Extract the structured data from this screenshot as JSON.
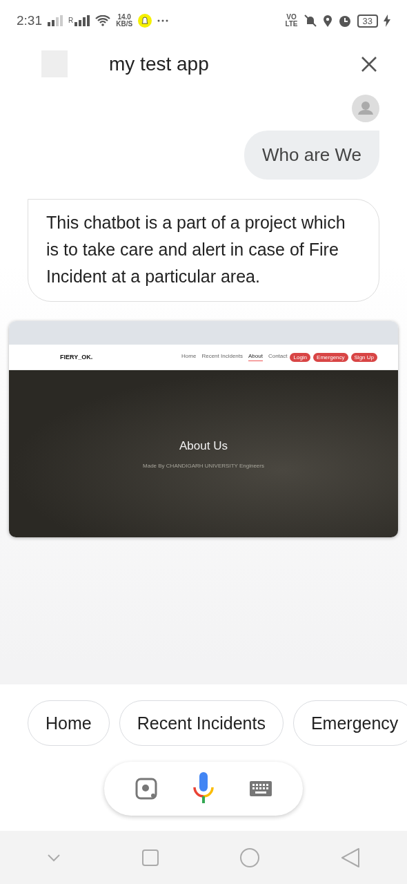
{
  "status_bar": {
    "time": "2:31",
    "roaming": "R",
    "speed_value": "14.0",
    "speed_unit": "KB/S",
    "volte_top": "VO",
    "volte_bottom": "LTE",
    "battery": "33"
  },
  "header": {
    "title": "my test app"
  },
  "messages": [
    {
      "kind": "user",
      "text": "Who are We"
    },
    {
      "kind": "bot",
      "text": "This chatbot is a part of a project which is to take care and alert in case of Fire Incident at a particular area."
    },
    {
      "kind": "screenshot",
      "brand": "FIERY_OK.",
      "nav_links": [
        {
          "label": "Home",
          "selected": false
        },
        {
          "label": "Recent Incidents",
          "selected": false
        },
        {
          "label": "About",
          "selected": true
        },
        {
          "label": "Contact",
          "selected": false
        }
      ],
      "nav_buttons": [
        "Login",
        "Emergency",
        "Sign Up"
      ],
      "hero_title": "About Us",
      "hero_subtitle": "Made By CHANDIGARH UNIVERSITY Engineers"
    }
  ],
  "suggestions": [
    "Home",
    "Recent Incidents",
    "Emergency"
  ]
}
